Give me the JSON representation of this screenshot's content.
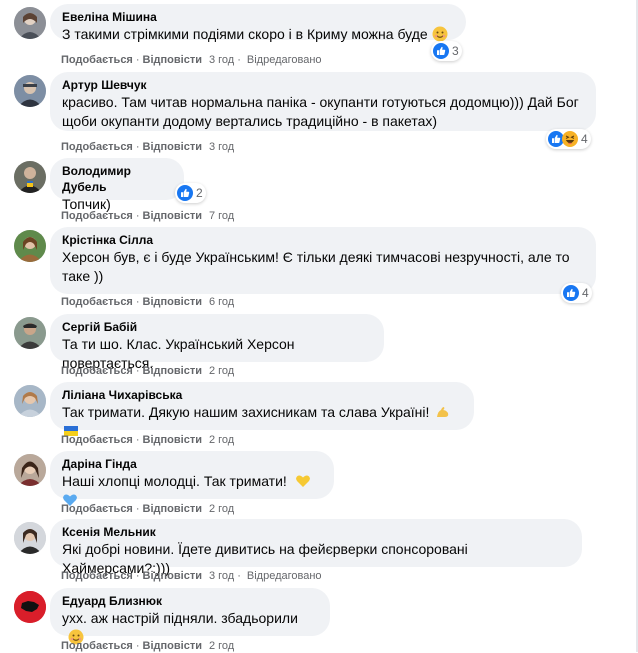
{
  "actions": {
    "like": "Подобається",
    "reply": "Відповісти",
    "edited": "Відредаговано"
  },
  "comments": [
    {
      "author": "Евеліна Мішина",
      "text": "З такими стрімкими подіями скоро і в Криму можна буде",
      "time": "3 год",
      "reactions": "3"
    },
    {
      "author": "Артур Шевчук",
      "text": "красиво. Там читав нормальна паніка - окупанти готуються додомцю))) Дай Бог\nщоби окупанти додому вертались традиційно - в пакетах)",
      "time": "3 год",
      "reactions": "4"
    },
    {
      "author": "Володимир Дубель",
      "text": "Топчик)",
      "time": "7 год",
      "reactions": "2"
    },
    {
      "author": "Крістінка Сілла",
      "text": "Херсон був, є і буде Українським! Є тільки деякі тимчасові незручності, але то\nтаке ))",
      "time": "6 год",
      "reactions": "4"
    },
    {
      "author": "Сергій Бабій",
      "text": "Та ти шо. Клас. Український Херсон повертається.",
      "time": "2 год"
    },
    {
      "author": "Ліліана Чихарівська",
      "text": "Так тримати. Дякую нашим захисникам та слава Україні!",
      "time": "2 год"
    },
    {
      "author": "Даріна Гінда",
      "text": "Наші хлопці молодці. Так тримати!",
      "time": "2 год"
    },
    {
      "author": "Ксенія Мельник",
      "text": "Які добрі новини. Їдете дивитись на фейєрверки спонсоровані Хаймерсами?:)))",
      "time": "3 год"
    },
    {
      "author": "Едуард Близнюк",
      "text": "ухх. аж настрій підняли. збадьорили",
      "time": "2 год"
    }
  ],
  "icons": {
    "like": "like-reaction-icon",
    "haha": "haha-reaction-icon",
    "smile": "smiling-emoji",
    "muscle": "flexed-biceps-emoji",
    "flag": "ukraine-flag-emoji",
    "yellow_heart": "yellow-heart-emoji",
    "blue_heart": "blue-heart-emoji"
  },
  "colors": {
    "bubble": "#f0f2f5",
    "meta": "#65676b",
    "like_blue": "#1877f2",
    "text": "#050505"
  }
}
